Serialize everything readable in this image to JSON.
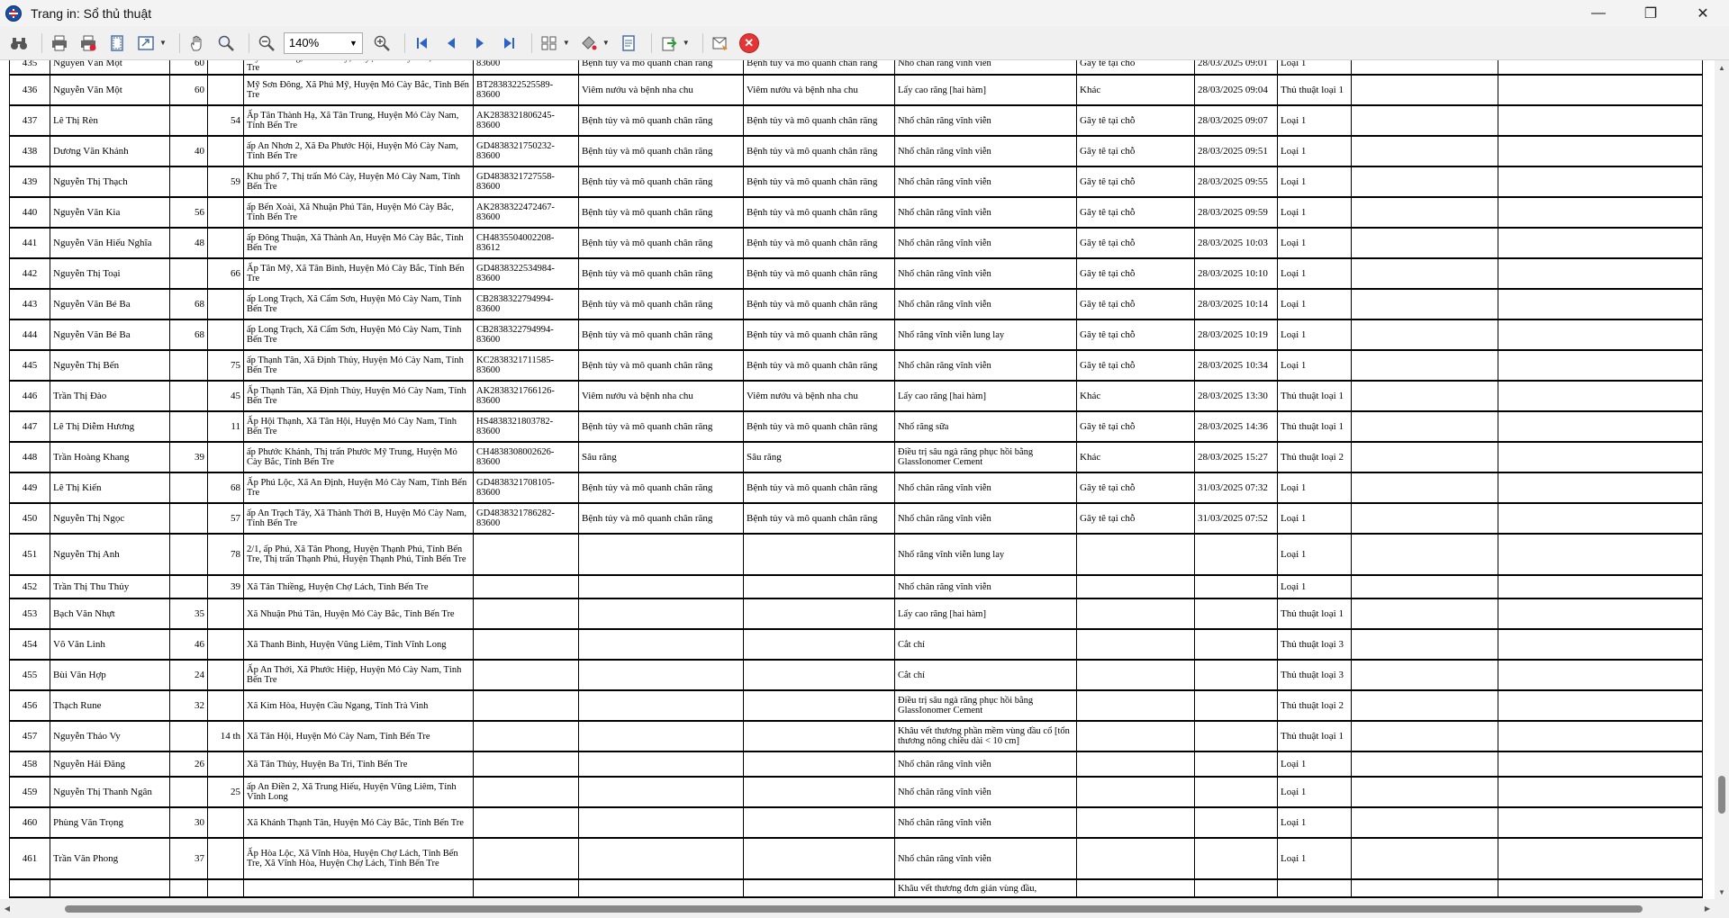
{
  "window": {
    "title": "Trang in: Sổ thủ thuật",
    "minimize": "—",
    "maximize": "❐",
    "close": "✕"
  },
  "toolbar": {
    "zoom": "140%",
    "icons": [
      "binoculars-icon",
      "print-icon",
      "quick-print-icon",
      "page-setup-icon",
      "scale-icon",
      "hand-tool-icon",
      "magnifier-icon",
      "zoom-out-icon",
      "zoom-in-icon",
      "first-page-icon",
      "prev-page-icon",
      "next-page-icon",
      "last-page-icon",
      "multipage-icon",
      "color-icon",
      "watermark-icon",
      "export-icon",
      "send-icon",
      "close-preview-icon"
    ]
  },
  "rows": [
    {
      "stt": "435",
      "name": "Nguyễn Văn Một",
      "age": "60",
      "age2": "",
      "addr": "Mỹ Sơn Đông, Xã Phú Mỹ, Huyện Mỏ Cày Bắc, Tỉnh Bến Tre",
      "code": "83600",
      "dx1": "Bệnh tủy và mô quanh chân răng",
      "dx2": "Bệnh tủy và mô quanh chân răng",
      "proc": "Nhổ chân răng vĩnh viễn",
      "anes": "Gây tê tại chỗ",
      "time": "28/03/2025 09:01",
      "type": "Loại 1"
    },
    {
      "stt": "436",
      "name": "Nguyễn Văn Một",
      "age": "60",
      "age2": "",
      "addr": "Mỹ Sơn Đông, Xã Phú Mỹ, Huyện Mỏ Cày Bắc, Tỉnh Bến Tre",
      "code": "BT2838322525589-83600",
      "dx1": "Viêm nướu và bệnh nha chu",
      "dx2": "Viêm nướu và bệnh nha chu",
      "proc": "Lấy cao răng [hai hàm]",
      "anes": "Khác",
      "time": "28/03/2025 09:04",
      "type": "Thủ thuật loại 1"
    },
    {
      "stt": "437",
      "name": "Lê Thị Rèn",
      "age": "",
      "age2": "54",
      "addr": "Ấp Tân Thành Hạ, Xã Tân Trung, Huyện Mỏ Cày Nam, Tỉnh Bến Tre",
      "code": "AK2838321806245-83600",
      "dx1": "Bệnh tủy và mô quanh chân răng",
      "dx2": "Bệnh tủy và mô quanh chân răng",
      "proc": "Nhổ chân răng vĩnh viễn",
      "anes": "Gây tê tại chỗ",
      "time": "28/03/2025 09:07",
      "type": "Loại 1"
    },
    {
      "stt": "438",
      "name": "Dương Văn Khánh",
      "age": "40",
      "age2": "",
      "addr": "ấp An Nhơn 2, Xã Đa Phước Hội, Huyện Mỏ Cày Nam, Tỉnh Bến Tre",
      "code": "GD4838321750232-83600",
      "dx1": "Bệnh tủy và mô quanh chân răng",
      "dx2": "Bệnh tủy và mô quanh chân răng",
      "proc": "Nhổ chân răng vĩnh viễn",
      "anes": "Gây tê tại chỗ",
      "time": "28/03/2025 09:51",
      "type": "Loại 1"
    },
    {
      "stt": "439",
      "name": "Nguyễn Thị Thạch",
      "age": "",
      "age2": "59",
      "addr": "Khu phố 7, Thị trấn Mỏ Cày, Huyện Mỏ Cày Nam, Tỉnh Bến Tre",
      "code": "GD4838321727558-83600",
      "dx1": "Bệnh tủy và mô quanh chân răng",
      "dx2": "Bệnh tủy và mô quanh chân răng",
      "proc": "Nhổ chân răng vĩnh viễn",
      "anes": "Gây tê tại chỗ",
      "time": "28/03/2025 09:55",
      "type": "Loại 1"
    },
    {
      "stt": "440",
      "name": "Nguyễn Văn Kia",
      "age": "56",
      "age2": "",
      "addr": "ấp Bến Xoài, Xã Nhuận Phú Tân, Huyện Mỏ Cày Bắc, Tỉnh Bến Tre",
      "code": "AK2838322472467-83600",
      "dx1": "Bệnh tủy và mô quanh chân răng",
      "dx2": "Bệnh tủy và mô quanh chân răng",
      "proc": "Nhổ chân răng vĩnh viễn",
      "anes": "Gây tê tại chỗ",
      "time": "28/03/2025 09:59",
      "type": "Loại 1"
    },
    {
      "stt": "441",
      "name": "Nguyễn Văn Hiếu Nghĩa",
      "age": "48",
      "age2": "",
      "addr": "ấp Đông Thuận, Xã Thành An, Huyện Mỏ Cày Bắc, Tỉnh Bến Tre",
      "code": "CH4835504002208-83612",
      "dx1": "Bệnh tủy và mô quanh chân răng",
      "dx2": "Bệnh tủy và mô quanh chân răng",
      "proc": "Nhổ chân răng vĩnh viễn",
      "anes": "Gây tê tại chỗ",
      "time": "28/03/2025 10:03",
      "type": "Loại 1"
    },
    {
      "stt": "442",
      "name": "Nguyễn Thị Toại",
      "age": "",
      "age2": "66",
      "addr": "Ấp Tân Mỹ, Xã Tân Bình, Huyện Mỏ Cày Bắc, Tỉnh Bến Tre",
      "code": "GD4838322534984-83600",
      "dx1": "Bệnh tủy và mô quanh chân răng",
      "dx2": "Bệnh tủy và mô quanh chân răng",
      "proc": "Nhổ chân răng vĩnh viễn",
      "anes": "Gây tê tại chỗ",
      "time": "28/03/2025 10:10",
      "type": "Loại 1"
    },
    {
      "stt": "443",
      "name": "Nguyễn Văn Bé Ba",
      "age": "68",
      "age2": "",
      "addr": "ấp Long Trạch, Xã Cẩm Sơn, Huyện Mỏ Cày Nam, Tỉnh Bến Tre",
      "code": "CB2838322794994-83600",
      "dx1": "Bệnh tủy và mô quanh chân răng",
      "dx2": "Bệnh tủy và mô quanh chân răng",
      "proc": "Nhổ chân răng vĩnh viễn",
      "anes": "Gây tê tại chỗ",
      "time": "28/03/2025 10:14",
      "type": "Loại 1"
    },
    {
      "stt": "444",
      "name": "Nguyễn Văn Bé Ba",
      "age": "68",
      "age2": "",
      "addr": "ấp Long Trạch, Xã Cẩm Sơn, Huyện Mỏ Cày Nam, Tỉnh Bến Tre",
      "code": "CB2838322794994-83600",
      "dx1": "Bệnh tủy và mô quanh chân răng",
      "dx2": "Bệnh tủy và mô quanh chân răng",
      "proc": "Nhổ răng vĩnh viễn lung lay",
      "anes": "Gây tê tại chỗ",
      "time": "28/03/2025 10:19",
      "type": "Loại 1"
    },
    {
      "stt": "445",
      "name": "Nguyễn Thị Bến",
      "age": "",
      "age2": "75",
      "addr": "ấp Thạnh Tân, Xã Định Thủy, Huyện Mỏ Cày Nam, Tỉnh Bến Tre",
      "code": "KC2838321711585-83600",
      "dx1": "Bệnh tủy và mô quanh chân răng",
      "dx2": "Bệnh tủy và mô quanh chân răng",
      "proc": "Nhổ chân răng vĩnh viễn",
      "anes": "Gây tê tại chỗ",
      "time": "28/03/2025 10:34",
      "type": "Loại 1"
    },
    {
      "stt": "446",
      "name": "Trần Thị Đào",
      "age": "",
      "age2": "45",
      "addr": "Ấp Thạnh Tân, Xã Định Thủy, Huyện Mỏ Cày Nam, Tỉnh Bến Tre",
      "code": "AK2838321766126-83600",
      "dx1": "Viêm nướu và bệnh nha chu",
      "dx2": "Viêm nướu và bệnh nha chu",
      "proc": "Lấy cao răng [hai hàm]",
      "anes": "Khác",
      "time": "28/03/2025 13:30",
      "type": "Thủ thuật loại 1"
    },
    {
      "stt": "447",
      "name": "Lê Thị Diễm Hương",
      "age": "",
      "age2": "11",
      "addr": "Ấp Hội Thạnh, Xã Tân Hội, Huyện Mỏ Cày Nam, Tỉnh Bến Tre",
      "code": "HS4838321803782-83600",
      "dx1": "Bệnh tủy và mô quanh chân răng",
      "dx2": "Bệnh tủy và mô quanh chân răng",
      "proc": "Nhổ răng sữa",
      "anes": "Gây tê tại chỗ",
      "time": "28/03/2025 14:36",
      "type": "Thủ thuật loại 1"
    },
    {
      "stt": "448",
      "name": "Trần Hoàng Khang",
      "age": "39",
      "age2": "",
      "addr": "ấp Phước Khánh, Thị trấn Phước Mỹ Trung, Huyện Mỏ Cày Bắc, Tỉnh Bến Tre",
      "code": "CH4838308002626-83600",
      "dx1": "Sâu răng",
      "dx2": "Sâu răng",
      "proc": "Điều trị sâu ngà răng phục hồi bằng GlassIonomer Cement",
      "anes": "Khác",
      "time": "28/03/2025 15:27",
      "type": "Thủ thuật loại 2"
    },
    {
      "stt": "449",
      "name": "Lê Thị Kiến",
      "age": "",
      "age2": "68",
      "addr": "Ấp Phú Lộc, Xã An Định, Huyện Mỏ Cày Nam, Tỉnh Bến Tre",
      "code": "GD4838321708105-83600",
      "dx1": "Bệnh tủy và mô quanh chân răng",
      "dx2": "Bệnh tủy và mô quanh chân răng",
      "proc": "Nhổ chân răng vĩnh viễn",
      "anes": "Gây tê tại chỗ",
      "time": "31/03/2025 07:32",
      "type": "Loại 1"
    },
    {
      "stt": "450",
      "name": "Nguyễn Thị Ngọc",
      "age": "",
      "age2": "57",
      "addr": "ấp An Trạch Tây, Xã Thành Thới B, Huyện Mỏ Cày Nam, Tỉnh Bến Tre",
      "code": "GD4838321786282-83600",
      "dx1": "Bệnh tủy và mô quanh chân răng",
      "dx2": "Bệnh tủy và mô quanh chân răng",
      "proc": "Nhổ chân răng vĩnh viễn",
      "anes": "Gây tê tại chỗ",
      "time": "31/03/2025 07:52",
      "type": "Loại 1"
    },
    {
      "stt": "451",
      "name": "Nguyễn Thị Anh",
      "age": "",
      "age2": "78",
      "addr": "2/1, ấp Phú, Xã Tân Phong, Huyện Thạnh Phú, Tỉnh Bến Tre, Thị trấn Thạnh Phú, Huyện Thạnh Phú, Tỉnh Bến Tre",
      "code": "",
      "dx1": "",
      "dx2": "",
      "proc": "Nhổ răng vĩnh viễn lung lay",
      "anes": "",
      "time": "",
      "type": "Loại 1"
    },
    {
      "stt": "452",
      "name": "Trần Thị Thu Thủy",
      "age": "",
      "age2": "39",
      "addr": "Xã Tân Thiềng, Huyện Chợ Lách, Tỉnh Bến Tre",
      "code": "",
      "dx1": "",
      "dx2": "",
      "proc": "Nhổ chân răng vĩnh viễn",
      "anes": "",
      "time": "",
      "type": "Loại 1"
    },
    {
      "stt": "453",
      "name": "Bạch Văn Nhựt",
      "age": "35",
      "age2": "",
      "addr": "Xã Nhuận Phú Tân, Huyện Mỏ Cày Bắc, Tỉnh Bến Tre",
      "code": "",
      "dx1": "",
      "dx2": "",
      "proc": "Lấy cao răng [hai hàm]",
      "anes": "",
      "time": "",
      "type": "Thủ thuật loại 1"
    },
    {
      "stt": "454",
      "name": "Võ Văn Linh",
      "age": "46",
      "age2": "",
      "addr": "Xã Thanh Bình, Huyện Vũng Liêm, Tỉnh Vĩnh Long",
      "code": "",
      "dx1": "",
      "dx2": "",
      "proc": "Cắt chỉ",
      "anes": "",
      "time": "",
      "type": "Thủ thuật loại 3"
    },
    {
      "stt": "455",
      "name": "Bùi Văn Hợp",
      "age": "24",
      "age2": "",
      "addr": "Ấp An Thới, Xã Phước Hiệp, Huyện Mỏ Cày Nam, Tỉnh Bến Tre",
      "code": "",
      "dx1": "",
      "dx2": "",
      "proc": "Cắt chỉ",
      "anes": "",
      "time": "",
      "type": "Thủ thuật loại 3"
    },
    {
      "stt": "456",
      "name": "Thạch Rune",
      "age": "32",
      "age2": "",
      "addr": "Xã Kim Hòa, Huyện Cầu Ngang, Tỉnh Trà Vinh",
      "code": "",
      "dx1": "",
      "dx2": "",
      "proc": "Điều trị sâu ngà răng phục hồi bằng GlassIonomer Cement",
      "anes": "",
      "time": "",
      "type": "Thủ thuật loại 2"
    },
    {
      "stt": "457",
      "name": "Nguyễn Thảo Vy",
      "age": "",
      "age2": "14 th",
      "addr": "Xã Tân Hội, Huyện Mỏ Cày Nam, Tỉnh Bến Tre",
      "code": "",
      "dx1": "",
      "dx2": "",
      "proc": "Khâu vết thương phần mềm vùng đầu cổ [tổn thương nông chiều dài < 10 cm]",
      "anes": "",
      "time": "",
      "type": "Thủ thuật loại 1"
    },
    {
      "stt": "458",
      "name": "Nguyễn Hải Đăng",
      "age": "26",
      "age2": "",
      "addr": "Xã Tân Thủy, Huyện Ba Tri, Tỉnh Bến Tre",
      "code": "",
      "dx1": "",
      "dx2": "",
      "proc": "Nhổ chân răng vĩnh viễn",
      "anes": "",
      "time": "",
      "type": "Loại 1"
    },
    {
      "stt": "459",
      "name": "Nguyễn Thị Thanh Ngân",
      "age": "",
      "age2": "25",
      "addr": "ấp An Điền 2, Xã Trung Hiếu, Huyện Vũng Liêm, Tỉnh Vĩnh Long",
      "code": "",
      "dx1": "",
      "dx2": "",
      "proc": "Nhổ chân răng vĩnh viễn",
      "anes": "",
      "time": "",
      "type": "Loại 1"
    },
    {
      "stt": "460",
      "name": "Phùng Văn Trọng",
      "age": "30",
      "age2": "",
      "addr": "Xã Khánh Thạnh Tân, Huyện Mỏ Cày Bắc, Tỉnh Bến Tre",
      "code": "",
      "dx1": "",
      "dx2": "",
      "proc": "Nhổ chân răng vĩnh viễn",
      "anes": "",
      "time": "",
      "type": "Loại 1"
    },
    {
      "stt": "461",
      "name": "Trần Văn Phong",
      "age": "37",
      "age2": "",
      "addr": "Ấp Hòa Lộc, Xã Vĩnh Hòa, Huyện Chợ Lách, Tỉnh Bến Tre, Xã Vĩnh Hòa, Huyện Chợ Lách, Tỉnh Bến Tre",
      "code": "",
      "dx1": "",
      "dx2": "",
      "proc": "Nhổ chân răng vĩnh viễn",
      "anes": "",
      "time": "",
      "type": "Loại 1"
    },
    {
      "stt": "",
      "name": "",
      "age": "",
      "age2": "",
      "addr": "",
      "code": "",
      "dx1": "",
      "dx2": "",
      "proc": "Khâu vết thương đơn giản vùng đầu,",
      "anes": "",
      "time": "",
      "type": ""
    }
  ]
}
